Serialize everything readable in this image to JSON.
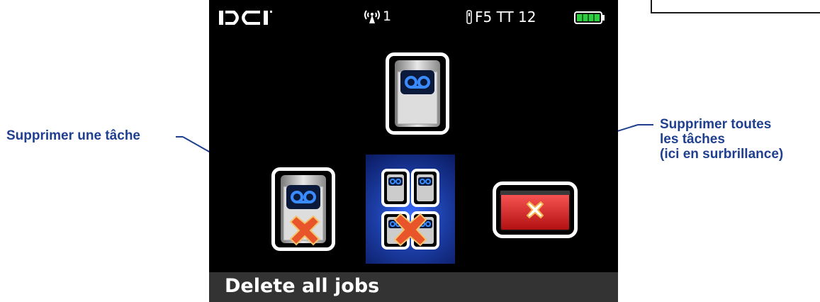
{
  "device": {
    "logo_text": "DCI",
    "signal_channel": "1",
    "frequency": "F5 TT 12",
    "battery_level": 1.0,
    "colors": {
      "battery": "#2ecc40",
      "highlight": "#1d3fa8",
      "cancel": "#d92020",
      "icon_blue": "#3a8bff",
      "delete_x": "#e8552a"
    }
  },
  "menu": {
    "items": [
      {
        "name": "job-icon",
        "selected": false
      },
      {
        "name": "delete-one-job",
        "selected": false
      },
      {
        "name": "delete-all-jobs",
        "selected": true
      },
      {
        "name": "cancel",
        "selected": false
      }
    ],
    "status_text": "Delete all jobs"
  },
  "callouts": {
    "left": "Supprimer une tâche",
    "right_line1": "Supprimer toutes",
    "right_line2": "les tâches",
    "right_line3": "(ici en surbrillance)"
  }
}
